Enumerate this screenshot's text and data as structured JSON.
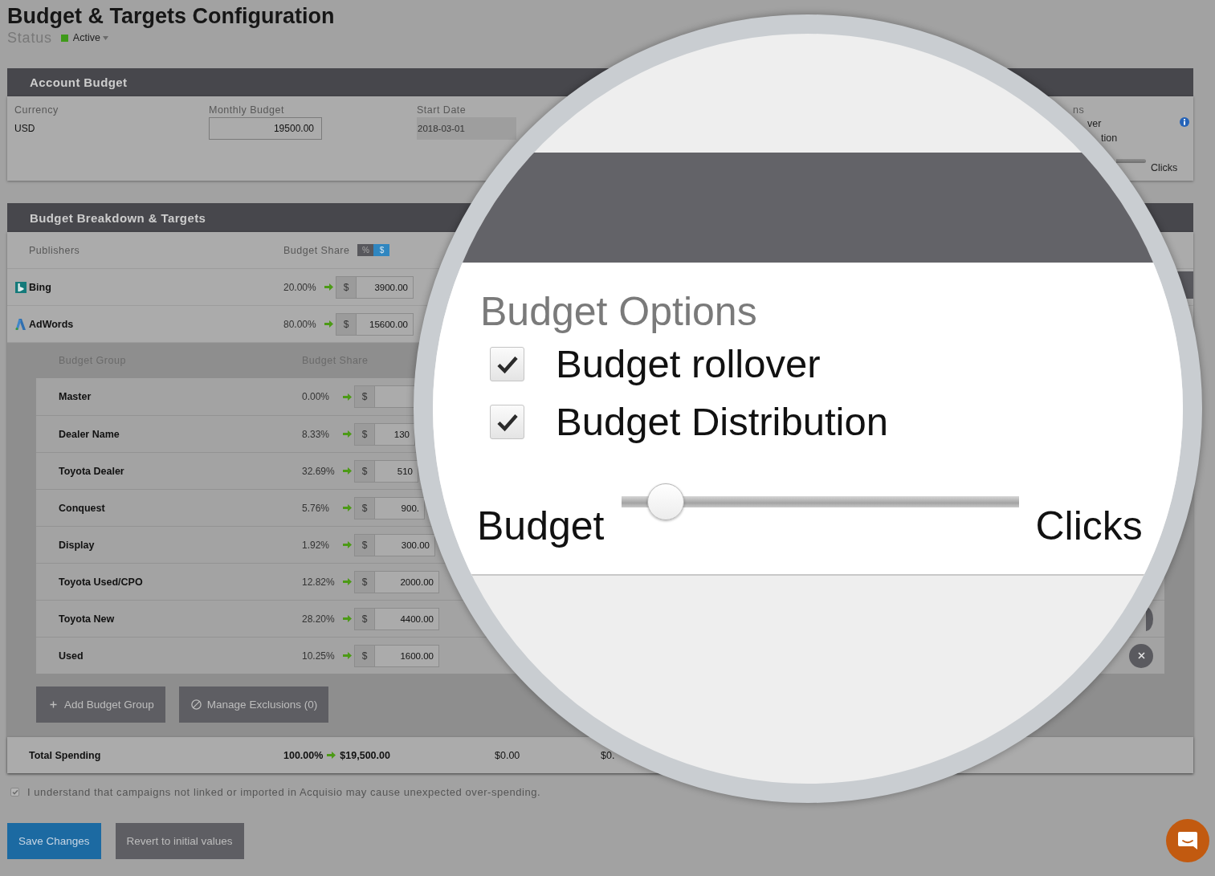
{
  "page": {
    "title": "Budget & Targets Configuration",
    "status_label": "Status",
    "status": "Active"
  },
  "account_budget": {
    "title": "Account Budget",
    "currency": {
      "label": "Currency",
      "value": "USD"
    },
    "monthly_budget": {
      "label": "Monthly Budget",
      "value": "19500.00"
    },
    "start_date": {
      "label": "Start Date",
      "value": "2018-03-01",
      "disabled": true
    },
    "options_visible_part": {
      "title": "ns",
      "options": [
        "ver",
        "tion"
      ],
      "slider_right_label": "Clicks"
    }
  },
  "breakdown": {
    "title": "Budget Breakdown & Targets",
    "columns": [
      "Publishers",
      "Budget Share"
    ],
    "share_mode": [
      {
        "label": "%",
        "selected": false
      },
      {
        "label": "$",
        "selected": true
      }
    ],
    "publishers": [
      {
        "kind": "bing",
        "name": "Bing",
        "share": "20.00%",
        "currency": "$",
        "amount": "3900.00"
      },
      {
        "kind": "adwords",
        "name": "AdWords",
        "share": "80.00%",
        "currency": "$",
        "amount": "15600.00"
      }
    ],
    "group_columns": [
      "Budget Group",
      "Budget Share"
    ],
    "groups": [
      {
        "name": "Master",
        "share": "0.00%",
        "currency": "$"
      },
      {
        "name": "Dealer Name",
        "share": "8.33%",
        "currency": "$",
        "amount": "130"
      },
      {
        "name": "Toyota Dealer",
        "share": "32.69%",
        "currency": "$",
        "amount": "510"
      },
      {
        "name": "Conquest",
        "share": "5.76%",
        "currency": "$",
        "amount": "900."
      },
      {
        "name": "Display",
        "share": "1.92%",
        "currency": "$",
        "amount": "300.00"
      },
      {
        "name": "Toyota Used/CPO",
        "share": "12.82%",
        "currency": "$",
        "amount": "2000.00"
      },
      {
        "name": "Toyota New",
        "share": "28.20%",
        "currency": "$",
        "amount": "4400.00",
        "delete_button": true
      },
      {
        "name": "Used",
        "share": "10.25%",
        "currency": "$",
        "amount": "1600.00",
        "delete_button": true
      }
    ],
    "group_actions": [
      {
        "kind": "add",
        "label": "Add Budget Group"
      },
      {
        "kind": "exclusions",
        "label": "Manage Exclusions (0)"
      }
    ],
    "total": {
      "label": "Total Spending",
      "share": "100.00%",
      "amount": "$19,500.00",
      "column_3": "$0.00",
      "column_4": "$0."
    }
  },
  "acknowledgement": {
    "checked": true,
    "text": "I understand that campaigns not linked or imported in Acquisio may cause unexpected over-spending."
  },
  "actions": [
    {
      "kind": "primary",
      "label": "Save Changes"
    },
    {
      "kind": "secondary",
      "label": "Revert to initial values"
    }
  ],
  "magnifier": {
    "title": "Budget Options",
    "options": [
      {
        "label": "Budget rollover",
        "checked": true
      },
      {
        "label": "Budget Distribution",
        "checked": true
      }
    ],
    "slider": {
      "left_label": "Budget",
      "right_label": "Clicks",
      "level": 0.11
    }
  }
}
